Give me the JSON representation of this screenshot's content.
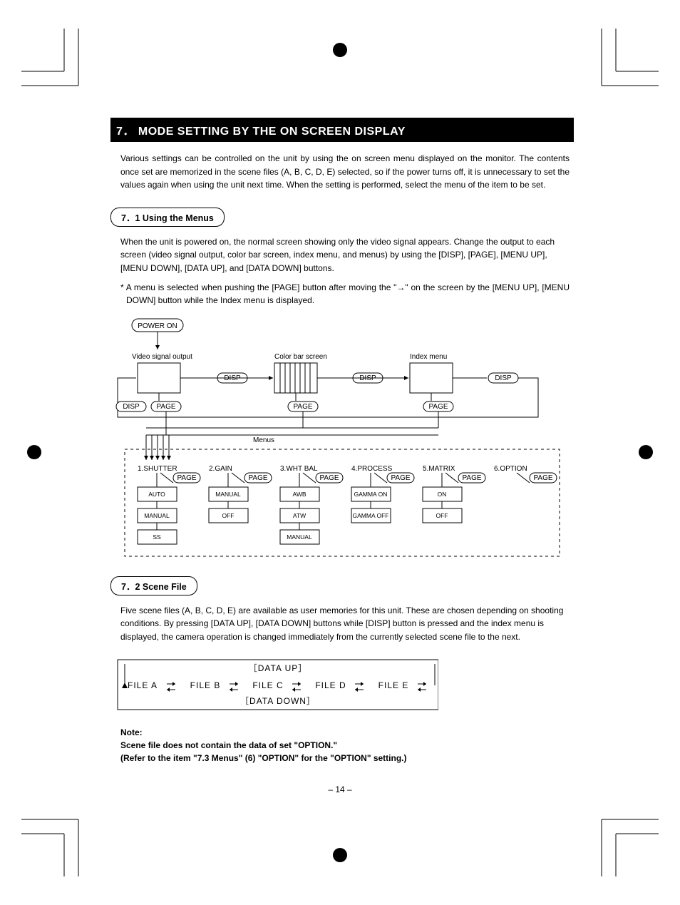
{
  "section": {
    "number": "7．",
    "title": "MODE SETTING BY THE ON SCREEN DISPLAY"
  },
  "intro": "Various settings can be controlled on the unit by using the on screen menu displayed on the monitor. The contents once set are memorized in the scene files (A, B, C, D, E) selected, so if the power turns off, it is unnecessary to set the values again when using the unit next time. When the setting is performed, select the menu of the item to be set.",
  "sub1": {
    "heading": "7．1   Using the Menus",
    "p1": "When the unit is powered on, the normal screen showing only the video signal appears. Change the output to each screen (video signal output, color bar screen, index menu, and menus) by using the [DISP],  [PAGE], [MENU UP], [MENU DOWN], [DATA UP], and [DATA DOWN] buttons.",
    "p2": "* A menu is selected when pushing the [PAGE] button after moving the \"→\" on the screen by the [MENU UP], [MENU DOWN] button while the Index menu is displayed."
  },
  "diagram": {
    "power_on": "POWER ON",
    "vso": "Video signal output",
    "cbs": "Color bar screen",
    "im": "Index menu",
    "disp": "DISP",
    "page": "PAGE",
    "menus": "Menus",
    "cols": [
      {
        "head": "1.SHUTTER",
        "opts": [
          "AUTO",
          "MANUAL",
          "SS"
        ]
      },
      {
        "head": "2.GAIN",
        "opts": [
          "MANUAL",
          "OFF"
        ]
      },
      {
        "head": "3.WHT BAL",
        "opts": [
          "AWB",
          "ATW",
          "MANUAL"
        ]
      },
      {
        "head": "4.PROCESS",
        "opts": [
          "GAMMA ON",
          "GAMMA OFF"
        ]
      },
      {
        "head": "5.MATRIX",
        "opts": [
          "ON",
          "OFF"
        ]
      },
      {
        "head": "6.OPTION",
        "opts": []
      }
    ]
  },
  "sub2": {
    "heading": "7．2   Scene File",
    "p1": "Five scene files (A, B, C, D, E) are available as user memories for this unit. These are chosen depending on shooting conditions. By pressing [DATA UP], [DATA DOWN] buttons while [DISP] button is pressed and the index menu is displayed, the camera operation is changed immediately from the currently selected scene file to the next."
  },
  "filebox": {
    "up": "［DATA UP］",
    "down": "［DATA DOWN］",
    "files": [
      "FILE A",
      "FILE B",
      "FILE C",
      "FILE D",
      "FILE E"
    ]
  },
  "note": {
    "title": "Note:",
    "l1": "Scene file does not contain the data of set \"OPTION.\"",
    "l2": "(Refer to the item \"7.3 Menus\" (6) \"OPTION\" for the \"OPTION\" setting.)"
  },
  "pagenum": "– 14 –"
}
